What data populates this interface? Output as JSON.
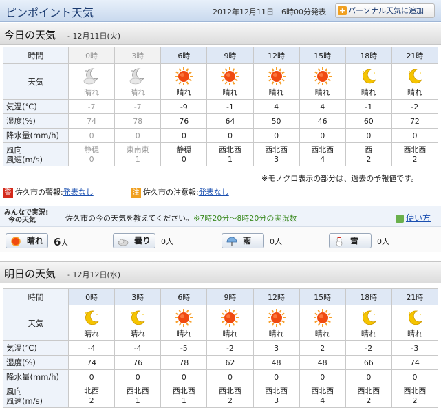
{
  "header": {
    "title": "ピンポイント天気",
    "issued": "2012年12月11日　6時00分発表",
    "personal_button": "パーソナル天気に追加"
  },
  "today": {
    "title": "今日の天気",
    "date": "- 12月11日(火)"
  },
  "tomorrow": {
    "title": "明日の天気",
    "date": "- 12月12日(水)"
  },
  "row_labels": {
    "time": "時間",
    "weather": "天気",
    "temp": "気温(℃)",
    "humidity": "湿度(%)",
    "precip": "降水量(mm/h)",
    "wind_dir": "風向",
    "wind_speed": "風速(m/s)"
  },
  "today_table": [
    {
      "time": "0時",
      "icon": "moon-cloud-icon",
      "weather": "晴れ",
      "temp": "-7",
      "humidity": "74",
      "precip": "0",
      "dir": "静穏",
      "speed": "0"
    },
    {
      "time": "3時",
      "icon": "moon-cloud-icon",
      "weather": "晴れ",
      "temp": "-7",
      "humidity": "78",
      "precip": "0",
      "dir": "東南東",
      "speed": "1"
    },
    {
      "time": "6時",
      "icon": "sun-icon",
      "weather": "晴れ",
      "temp": "-9",
      "humidity": "76",
      "precip": "0",
      "dir": "静穏",
      "speed": "0"
    },
    {
      "time": "9時",
      "icon": "sun-icon",
      "weather": "晴れ",
      "temp": "-1",
      "humidity": "64",
      "precip": "0",
      "dir": "西北西",
      "speed": "1"
    },
    {
      "time": "12時",
      "icon": "sun-icon",
      "weather": "晴れ",
      "temp": "4",
      "humidity": "50",
      "precip": "0",
      "dir": "西北西",
      "speed": "3"
    },
    {
      "time": "15時",
      "icon": "sun-icon",
      "weather": "晴れ",
      "temp": "4",
      "humidity": "46",
      "precip": "0",
      "dir": "西北西",
      "speed": "4"
    },
    {
      "time": "18時",
      "icon": "moon-icon",
      "weather": "晴れ",
      "temp": "-1",
      "humidity": "60",
      "precip": "0",
      "dir": "西",
      "speed": "2"
    },
    {
      "time": "21時",
      "icon": "moon-icon",
      "weather": "晴れ",
      "temp": "-2",
      "humidity": "72",
      "precip": "0",
      "dir": "西北西",
      "speed": "2"
    }
  ],
  "tomorrow_table": [
    {
      "time": "0時",
      "icon": "moon-icon",
      "weather": "晴れ",
      "temp": "-4",
      "humidity": "74",
      "precip": "0",
      "dir": "北西",
      "speed": "2"
    },
    {
      "time": "3時",
      "icon": "moon-icon",
      "weather": "晴れ",
      "temp": "-4",
      "humidity": "76",
      "precip": "0",
      "dir": "西北西",
      "speed": "1"
    },
    {
      "time": "6時",
      "icon": "sun-icon",
      "weather": "晴れ",
      "temp": "-5",
      "humidity": "78",
      "precip": "0",
      "dir": "西北西",
      "speed": "1"
    },
    {
      "time": "9時",
      "icon": "sun-icon",
      "weather": "晴れ",
      "temp": "-2",
      "humidity": "62",
      "precip": "0",
      "dir": "西北西",
      "speed": "2"
    },
    {
      "time": "12時",
      "icon": "sun-icon",
      "weather": "晴れ",
      "temp": "3",
      "humidity": "48",
      "precip": "0",
      "dir": "西北西",
      "speed": "3"
    },
    {
      "time": "15時",
      "icon": "sun-icon",
      "weather": "晴れ",
      "temp": "2",
      "humidity": "48",
      "precip": "0",
      "dir": "西北西",
      "speed": "4"
    },
    {
      "time": "18時",
      "icon": "moon-icon",
      "weather": "晴れ",
      "temp": "-2",
      "humidity": "66",
      "precip": "0",
      "dir": "西北西",
      "speed": "2"
    },
    {
      "time": "21時",
      "icon": "moon-icon",
      "weather": "晴れ",
      "temp": "-3",
      "humidity": "74",
      "precip": "0",
      "dir": "西北西",
      "speed": "2"
    }
  ],
  "past_columns_today": 2,
  "note": "※モノクロ表示の部分は、過去の予報値です。",
  "warnings": {
    "warning_badge": "警",
    "warning_label": "佐久市の警報:",
    "warning_link": "発表なし",
    "advisory_badge": "注",
    "advisory_label": "佐久市の注意報:",
    "advisory_link": "発表なし"
  },
  "minna": {
    "logo_line1": "みんなで実況!",
    "logo_line2": "今の天気",
    "prompt": "佐久市の今の天気を教えてください。",
    "hours": "※7時20分～8時20分の実況数",
    "help": "使い方",
    "votes": [
      {
        "label": "晴れ",
        "count": "6",
        "unit": "人",
        "icon": "sun-icon"
      },
      {
        "label": "曇り",
        "count": "0",
        "unit": "人",
        "icon": "cloud-icon"
      },
      {
        "label": "雨",
        "count": "0",
        "unit": "人",
        "icon": "umbrella-icon"
      },
      {
        "label": "雪",
        "count": "0",
        "unit": "人",
        "icon": "snowman-icon"
      }
    ]
  },
  "colors": {
    "sun": "#f04a10",
    "moon": "#f5c400",
    "header_blue": "#1a3a70",
    "link": "#1a4fb0"
  }
}
